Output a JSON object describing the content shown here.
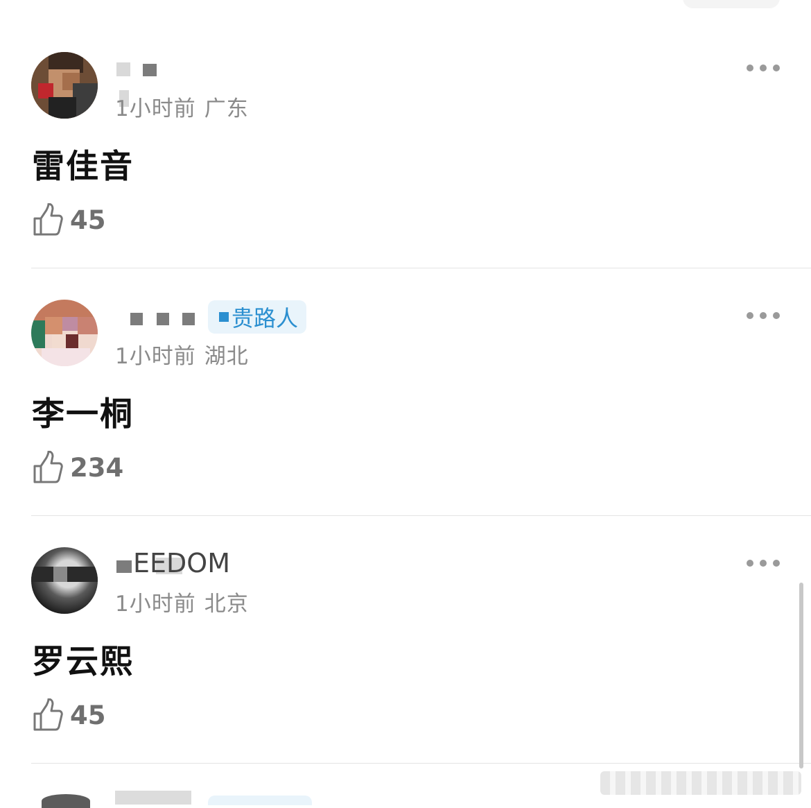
{
  "comments": [
    {
      "username": "",
      "time": "1小时前",
      "location": "广东",
      "content": "雷佳音",
      "likes": "45"
    },
    {
      "username": "",
      "badge": "贵路人",
      "time": "1小时前",
      "location": "湖北",
      "content": "李一桐",
      "likes": "234"
    },
    {
      "username": "EEDOM",
      "time": "1小时前",
      "location": "北京",
      "content": "罗云熙",
      "likes": "45"
    }
  ],
  "colors": {
    "badge_text": "#2b8fd0",
    "badge_bg": "#e9f4fb",
    "meta_text": "#8a8a8a",
    "like_text": "#6f6f6f"
  },
  "icons": {
    "like": "thumbs-up-icon",
    "more": "more-dots-icon"
  }
}
